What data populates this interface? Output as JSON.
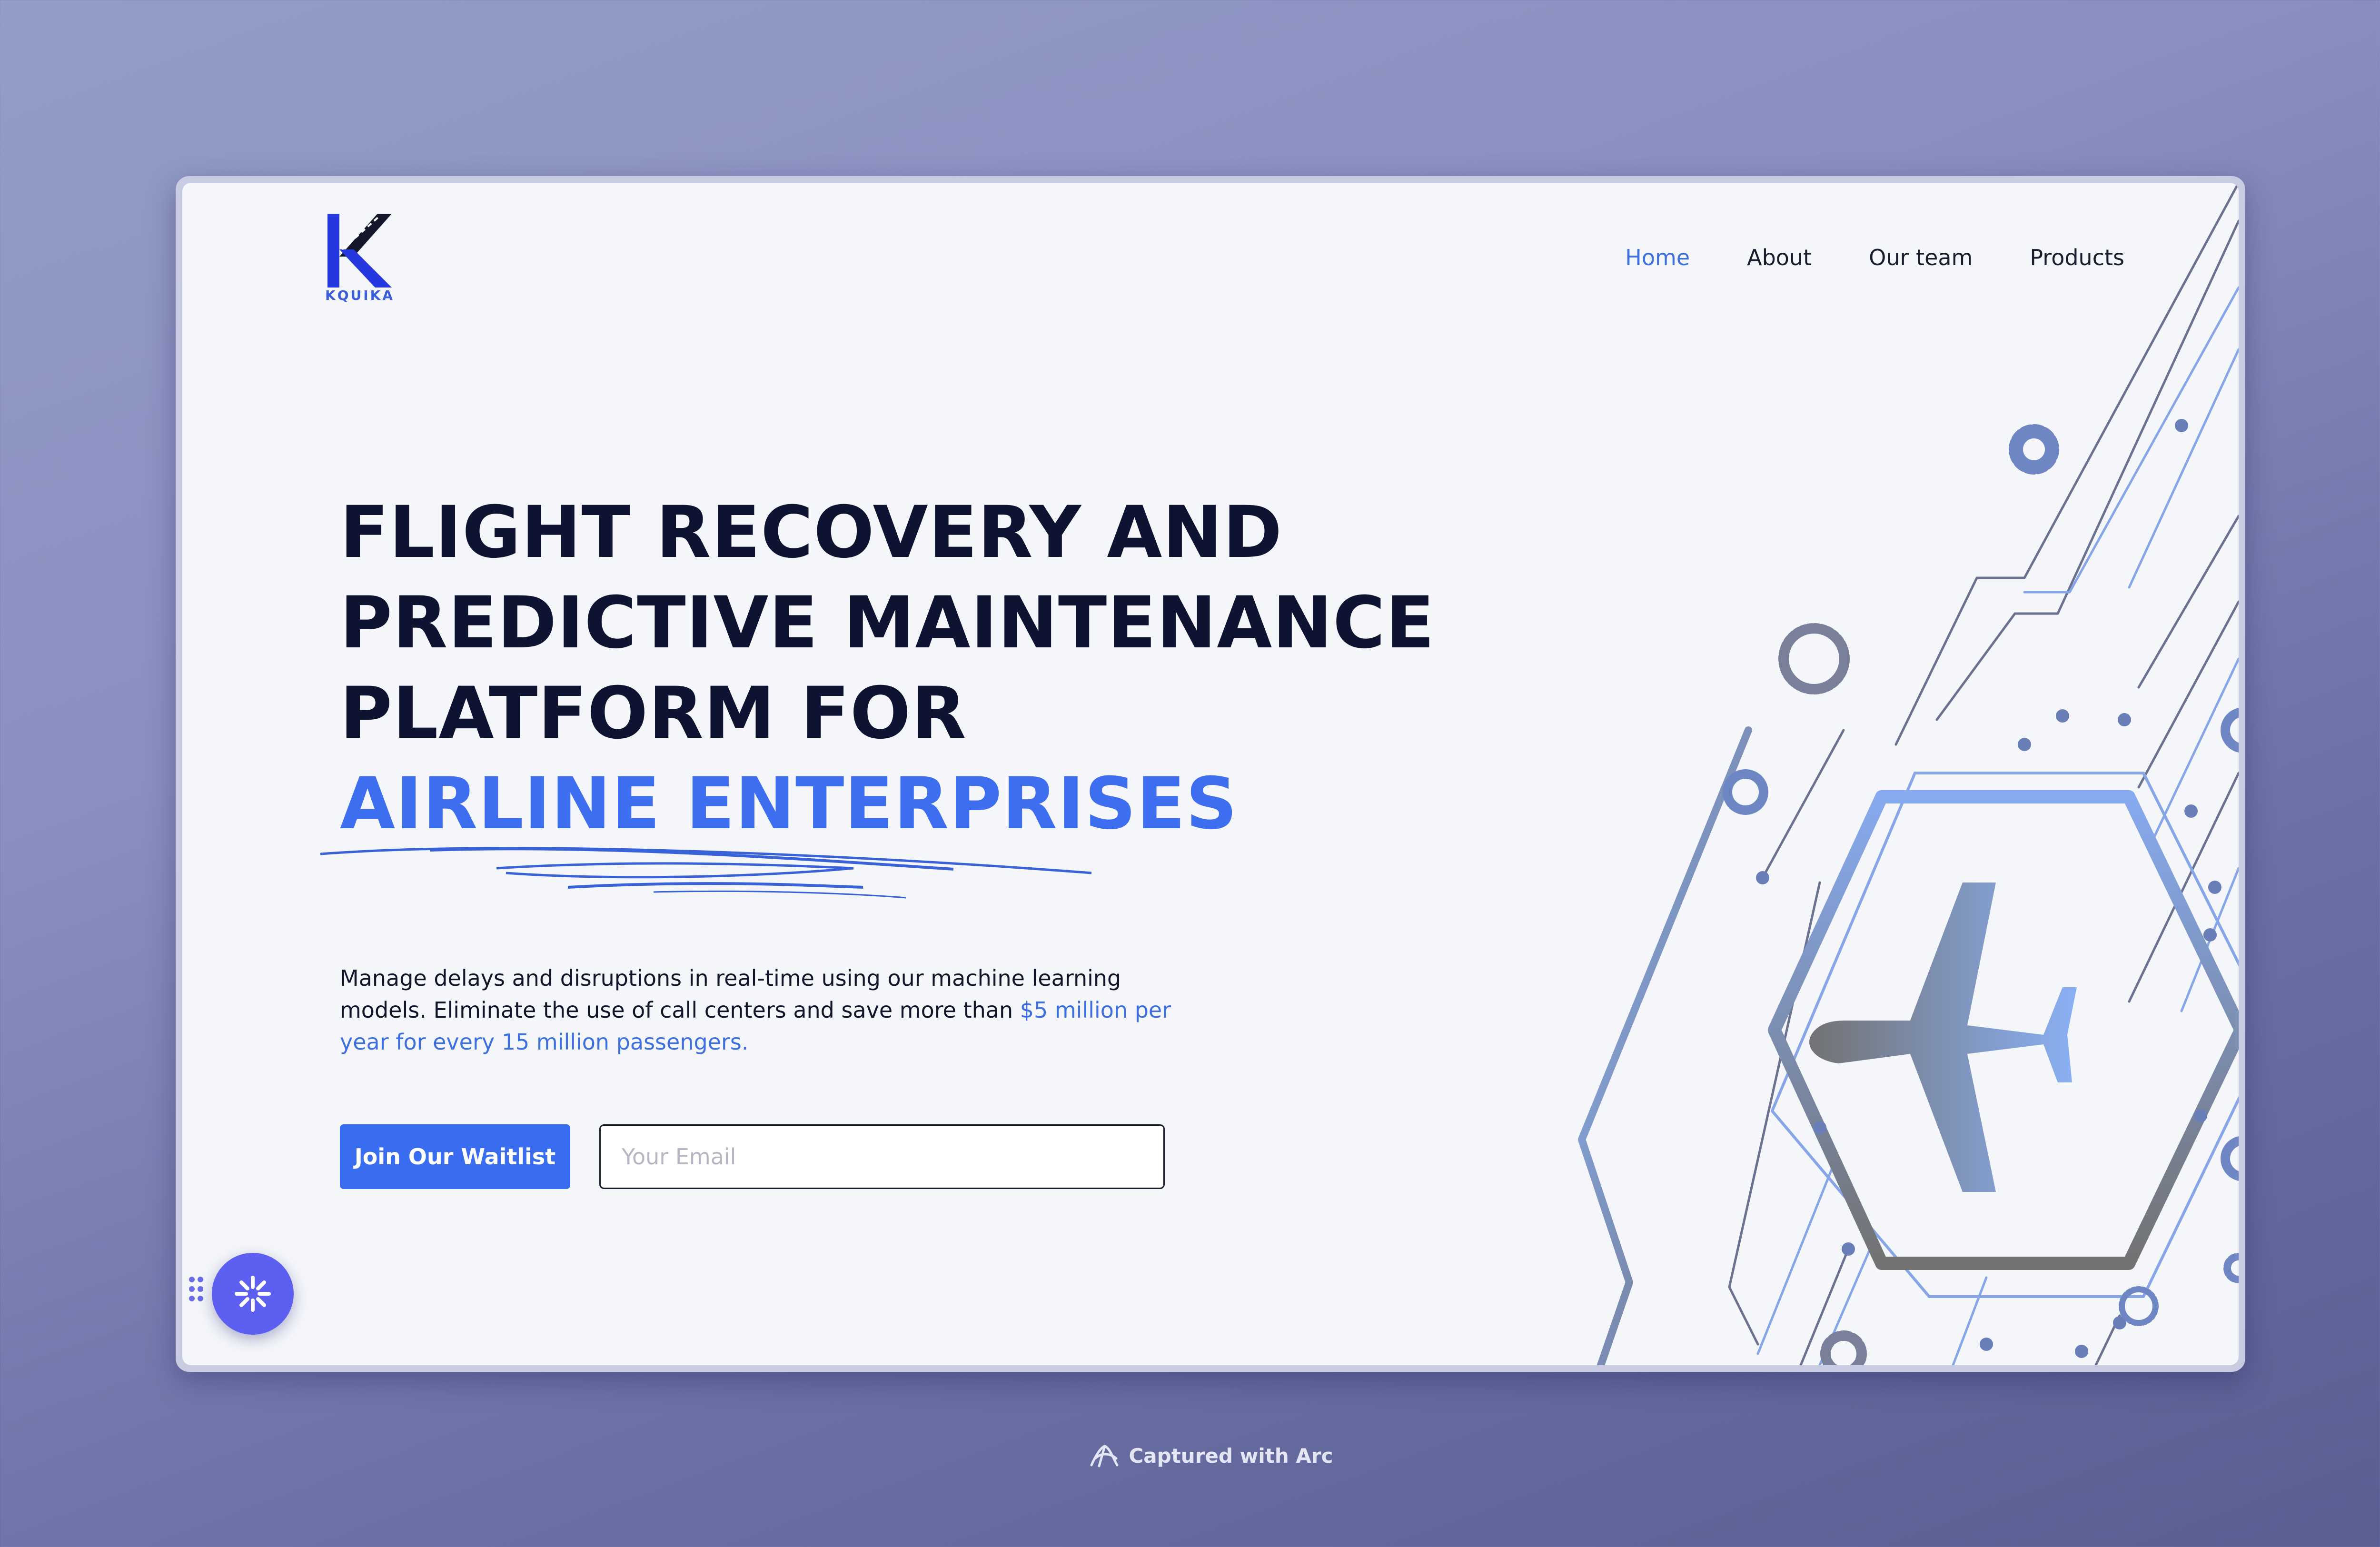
{
  "brand": {
    "name": "KQUIKA",
    "accent_color": "#3a5ddc"
  },
  "nav": {
    "items": [
      {
        "label": "Home",
        "active": true
      },
      {
        "label": "About",
        "active": false
      },
      {
        "label": "Our team",
        "active": false
      },
      {
        "label": "Products",
        "active": false
      }
    ]
  },
  "hero": {
    "title_lines": [
      "FLIGHT RECOVERY AND",
      "PREDICTIVE MAINTENANCE",
      "PLATFORM FOR"
    ],
    "title_accent": "AIRLINE ENTERPRISES",
    "description_plain": "Manage delays and disruptions in real-time using our machine learning models. Eliminate the use of call centers and save more than ",
    "description_highlight": "$5 million per year for every 15 million passengers.",
    "cta_label": "Join Our Waitlist",
    "email_placeholder": "Your Email",
    "email_value": ""
  },
  "illustration": {
    "icon": "airplane-circuit-hexagon-icon"
  },
  "widget": {
    "icon": "sparkle-icon",
    "handle_icon": "drag-handle-icon"
  },
  "footer": {
    "text": "Captured with Arc",
    "icon": "arc-logo-icon"
  },
  "colors": {
    "primary": "#3a6cf0",
    "heading": "#0d1330",
    "link": "#3d6fe0"
  }
}
